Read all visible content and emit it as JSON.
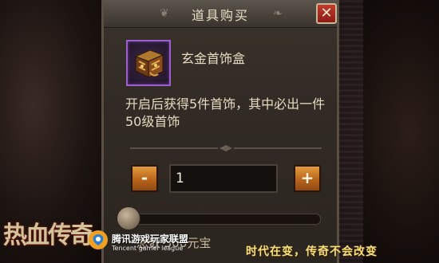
{
  "dialog": {
    "title": "道具购买",
    "close_label": "✕"
  },
  "item": {
    "name": "玄金首饰盒",
    "icon": "jewelry-box-icon",
    "rarity_color": "#9b5fd0",
    "description": "开启后获得5件首饰，其中必出一件50级首饰"
  },
  "quantity": {
    "minus_label": "-",
    "plus_label": "+",
    "value": "1",
    "slider_fraction": 0.0
  },
  "total": {
    "text": "总数    500元宝"
  },
  "watermark": {
    "game_logo": "热血传奇",
    "tencent_cn": "腾讯游戏玩家联盟",
    "tencent_en": "Tencent gamer league",
    "slogan": "时代在变，传奇不会改变"
  },
  "colors": {
    "button_orange": "#c9782a",
    "close_red": "#b02e22",
    "text_light": "#e6dac2",
    "slogan_yellow": "#f6e07a"
  }
}
